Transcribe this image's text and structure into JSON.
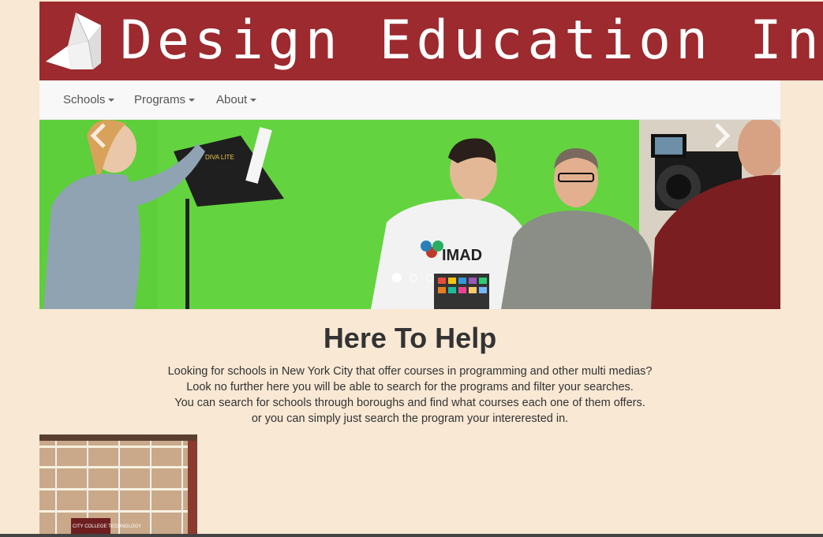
{
  "banner": {
    "title": "Design Education In C"
  },
  "nav": {
    "items": [
      {
        "label": "Schools"
      },
      {
        "label": "Programs"
      },
      {
        "label": "About"
      }
    ]
  },
  "carousel": {
    "slide_count": 3,
    "active_index": 0,
    "tshirt_text": "IMAD",
    "light_text": "DIVA LITE"
  },
  "main": {
    "heading": "Here To Help",
    "paragraph_lines": [
      "Looking for schools in New York City that offer courses in programming and other multi medias?",
      "Look no further here you will be able to search for the programs and filter your searches.",
      "You can search for schools through boroughs and find what courses each one of them offers.",
      "or you can simply just search the program your intererested in."
    ]
  },
  "thumbnail": {
    "sign_text": "CITY COLLEGE TECHNOLOGY"
  },
  "colors": {
    "banner_bg": "#9c2a2e",
    "page_bg": "#f8e8d4",
    "navbar_bg": "#f8f8f8",
    "green_screen": "#5ccf3a"
  }
}
